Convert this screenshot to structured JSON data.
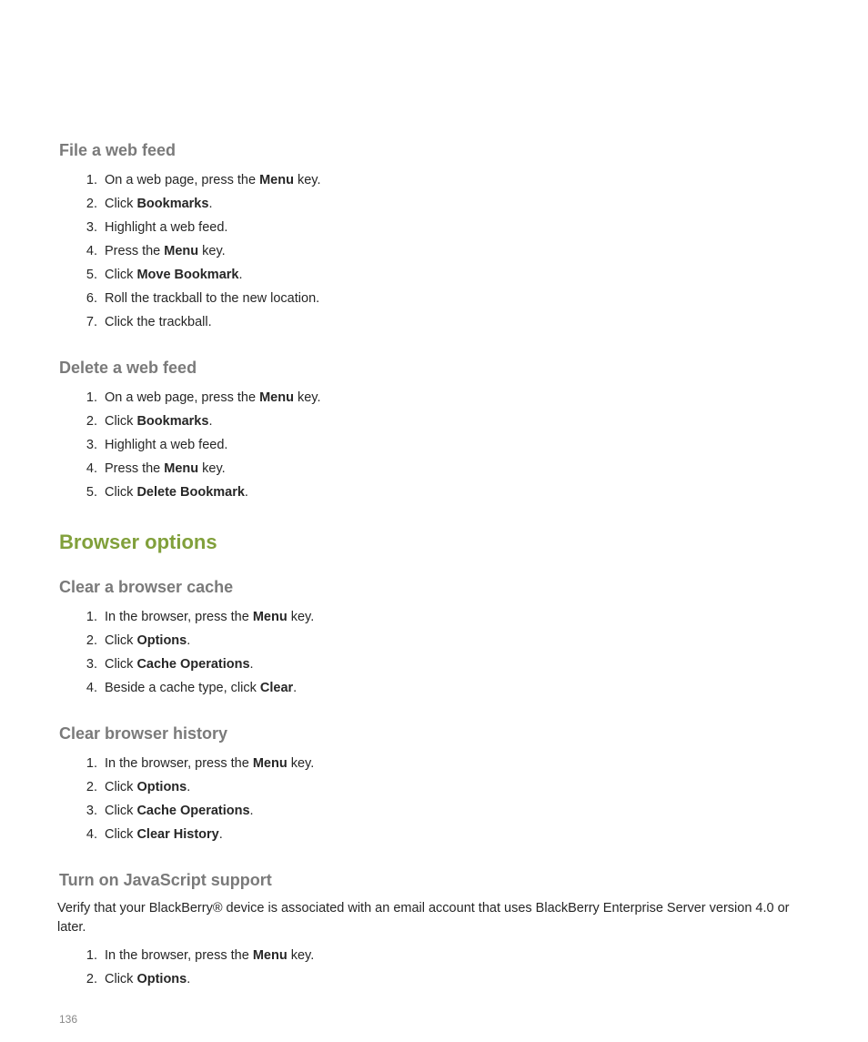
{
  "sections": {
    "fileWebFeed": {
      "title": "File a web feed",
      "steps": [
        [
          {
            "t": "On a web page, press the "
          },
          {
            "t": "Menu",
            "b": true
          },
          {
            "t": " key."
          }
        ],
        [
          {
            "t": "Click "
          },
          {
            "t": "Bookmarks",
            "b": true
          },
          {
            "t": "."
          }
        ],
        [
          {
            "t": "Highlight a web feed."
          }
        ],
        [
          {
            "t": "Press the "
          },
          {
            "t": "Menu",
            "b": true
          },
          {
            "t": " key."
          }
        ],
        [
          {
            "t": "Click "
          },
          {
            "t": "Move Bookmark",
            "b": true
          },
          {
            "t": "."
          }
        ],
        [
          {
            "t": "Roll the trackball to the new location."
          }
        ],
        [
          {
            "t": "Click the trackball."
          }
        ]
      ]
    },
    "deleteWebFeed": {
      "title": "Delete a web feed",
      "steps": [
        [
          {
            "t": "On a web page, press the "
          },
          {
            "t": "Menu",
            "b": true
          },
          {
            "t": " key."
          }
        ],
        [
          {
            "t": "Click "
          },
          {
            "t": "Bookmarks",
            "b": true
          },
          {
            "t": "."
          }
        ],
        [
          {
            "t": "Highlight a web feed."
          }
        ],
        [
          {
            "t": "Press the "
          },
          {
            "t": "Menu",
            "b": true
          },
          {
            "t": " key."
          }
        ],
        [
          {
            "t": "Click "
          },
          {
            "t": "Delete Bookmark",
            "b": true
          },
          {
            "t": "."
          }
        ]
      ]
    },
    "browserOptions": {
      "title": "Browser options"
    },
    "clearCache": {
      "title": "Clear a browser cache",
      "steps": [
        [
          {
            "t": "In the browser, press the "
          },
          {
            "t": "Menu",
            "b": true
          },
          {
            "t": " key."
          }
        ],
        [
          {
            "t": "Click "
          },
          {
            "t": "Options",
            "b": true
          },
          {
            "t": "."
          }
        ],
        [
          {
            "t": "Click "
          },
          {
            "t": "Cache Operations",
            "b": true
          },
          {
            "t": "."
          }
        ],
        [
          {
            "t": "Beside a cache type, click "
          },
          {
            "t": "Clear",
            "b": true
          },
          {
            "t": "."
          }
        ]
      ]
    },
    "clearHistory": {
      "title": "Clear browser history",
      "steps": [
        [
          {
            "t": "In the browser, press the "
          },
          {
            "t": "Menu",
            "b": true
          },
          {
            "t": " key."
          }
        ],
        [
          {
            "t": "Click "
          },
          {
            "t": "Options",
            "b": true
          },
          {
            "t": "."
          }
        ],
        [
          {
            "t": "Click "
          },
          {
            "t": "Cache Operations",
            "b": true
          },
          {
            "t": "."
          }
        ],
        [
          {
            "t": "Click "
          },
          {
            "t": "Clear History",
            "b": true
          },
          {
            "t": "."
          }
        ]
      ]
    },
    "jsSupport": {
      "title": "Turn on JavaScript support",
      "note": "Verify that your BlackBerry® device is associated with an email account that uses BlackBerry Enterprise Server version 4.0 or later.",
      "steps": [
        [
          {
            "t": "In the browser, press the "
          },
          {
            "t": "Menu",
            "b": true
          },
          {
            "t": " key."
          }
        ],
        [
          {
            "t": "Click "
          },
          {
            "t": "Options",
            "b": true
          },
          {
            "t": "."
          }
        ]
      ]
    }
  },
  "pageNumber": "136"
}
